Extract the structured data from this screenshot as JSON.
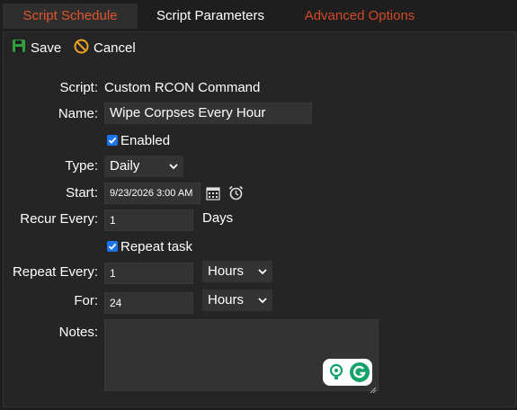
{
  "tabs": [
    {
      "label": "Script Schedule",
      "state": "active"
    },
    {
      "label": "Script Parameters",
      "state": "normal"
    },
    {
      "label": "Advanced Options",
      "state": "warning"
    }
  ],
  "toolbar": {
    "save_label": "Save",
    "cancel_label": "Cancel"
  },
  "form": {
    "script": {
      "label": "Script:",
      "value": "Custom RCON Command"
    },
    "name": {
      "label": "Name:",
      "value": "Wipe Corpses Every Hour"
    },
    "enabled": {
      "label": "Enabled",
      "checked": true
    },
    "type": {
      "label": "Type:",
      "value": "Daily"
    },
    "start": {
      "label": "Start:",
      "value": "9/23/2026 3:00 AM"
    },
    "recur_every": {
      "label": "Recur Every:",
      "value": "1",
      "unit": "Days"
    },
    "repeat_task": {
      "label": "Repeat task",
      "checked": true
    },
    "repeat_every": {
      "label": "Repeat Every:",
      "value": "1",
      "unit": "Hours"
    },
    "for": {
      "label": "For:",
      "value": "24",
      "unit": "Hours"
    },
    "notes": {
      "label": "Notes:",
      "value": ""
    }
  },
  "colors": {
    "active_tab_text": "#e0562c",
    "warning_tab_text": "#d24a2a",
    "save_icon": "#2e9e3e",
    "cancel_icon": "#f0a020",
    "checkbox": "#1a73e8",
    "grammarly_green": "#15a36a"
  }
}
